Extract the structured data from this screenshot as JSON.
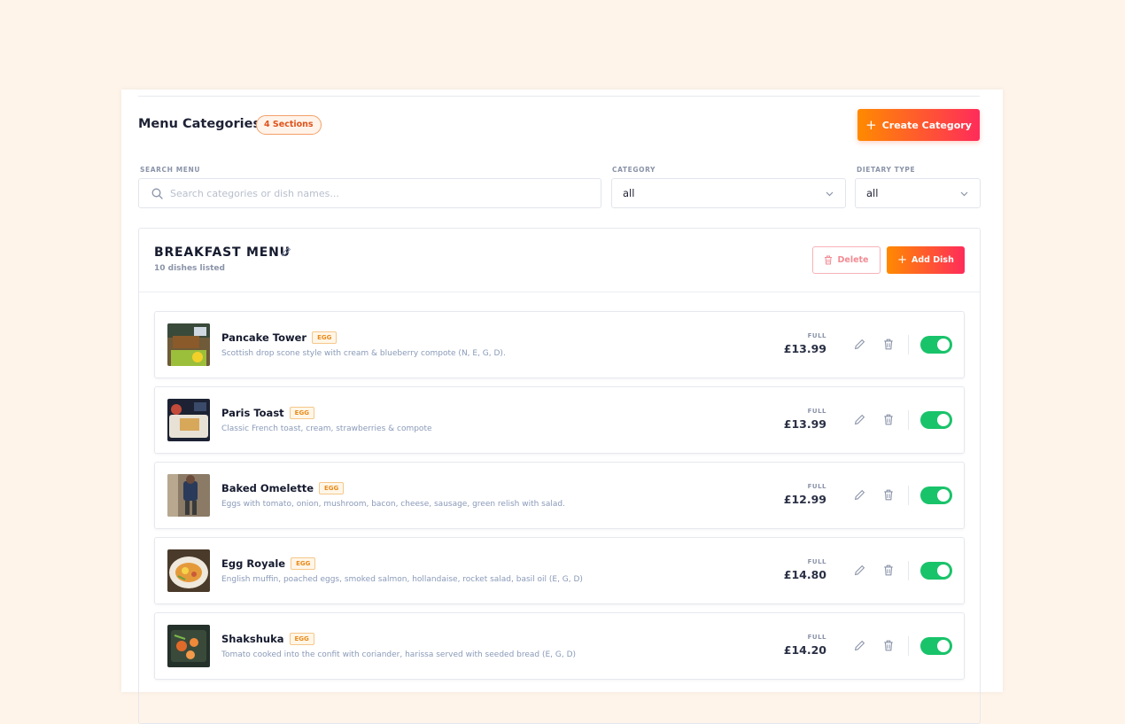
{
  "header": {
    "title": "Menu Categories",
    "sections_badge": "4 Sections",
    "create_button": "Create Category"
  },
  "filters": {
    "search_label": "SEARCH MENU",
    "search_placeholder": "Search categories or dish names...",
    "category_label": "CATEGORY",
    "category_value": "all",
    "dietary_label": "DIETARY TYPE",
    "dietary_value": "all"
  },
  "section": {
    "title": "BREAKFAST MENU",
    "subtitle": "10 dishes listed",
    "delete_button": "Delete",
    "add_button": "Add Dish"
  },
  "dishes": [
    {
      "name": "Pancake Tower",
      "tag": "EGG",
      "description": "Scottish drop scone style with cream & blueberry compote (N, E, G, D).",
      "price_label": "FULL",
      "price": "£13.99",
      "enabled": true
    },
    {
      "name": "Paris Toast",
      "tag": "EGG",
      "description": "Classic French toast, cream, strawberries & compote",
      "price_label": "FULL",
      "price": "£13.99",
      "enabled": true
    },
    {
      "name": "Baked Omelette",
      "tag": "EGG",
      "description": "Eggs with tomato, onion, mushroom, bacon, cheese, sausage, green relish with salad.",
      "price_label": "FULL",
      "price": "£12.99",
      "enabled": true
    },
    {
      "name": "Egg Royale",
      "tag": "EGG",
      "description": "English muffin, poached eggs, smoked salmon, hollandaise, rocket salad, basil oil (E, G, D)",
      "price_label": "FULL",
      "price": "£14.80",
      "enabled": true
    },
    {
      "name": "Shakshuka",
      "tag": "EGG",
      "description": "Tomato cooked into the confit with coriander, harissa served with seeded bread (E, G, D)",
      "price_label": "FULL",
      "price": "£14.20",
      "enabled": true
    }
  ],
  "colors": {
    "background": "#fef4ea",
    "accent_start": "#ff8a00",
    "accent_end": "#ff2c5a",
    "toggle_on": "#19c36a"
  }
}
